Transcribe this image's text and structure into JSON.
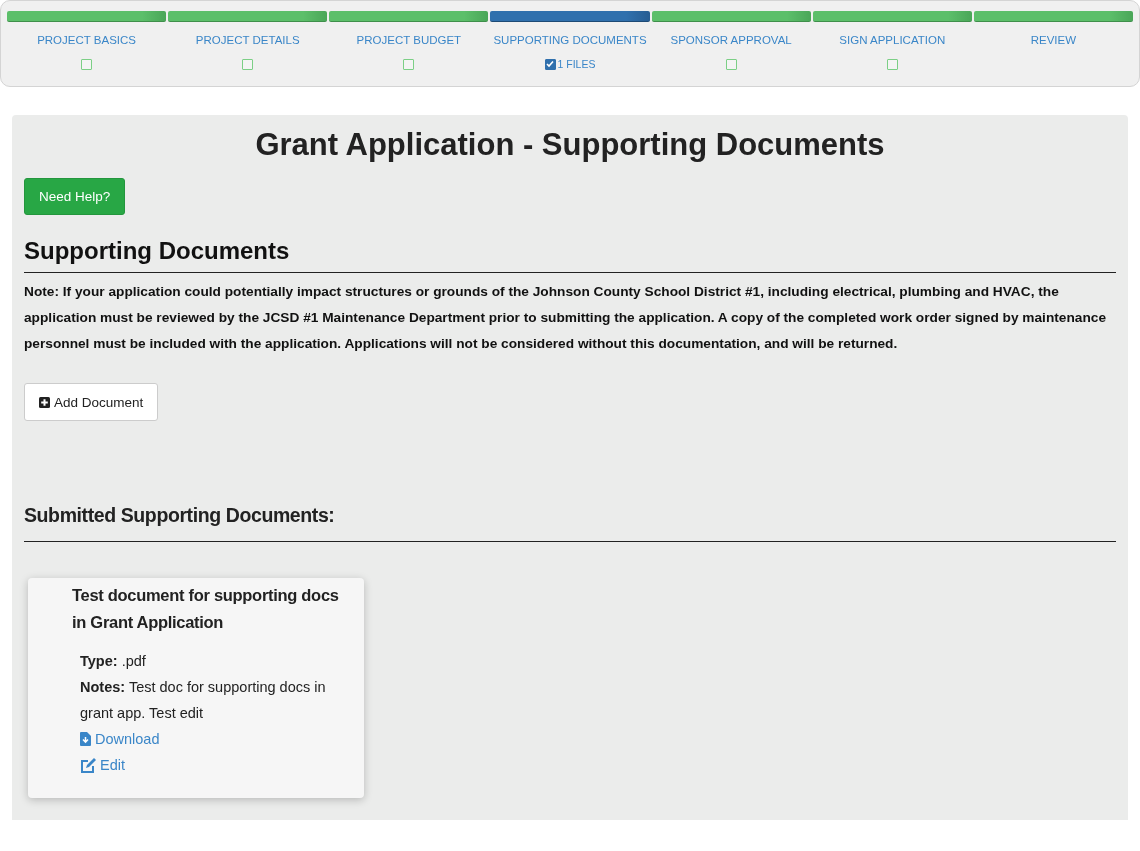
{
  "steps": [
    {
      "label": "PROJECT BASICS",
      "selected": false,
      "checkbox": {
        "checked": false
      }
    },
    {
      "label": "PROJECT DETAILS",
      "selected": false,
      "checkbox": {
        "checked": false
      }
    },
    {
      "label": "PROJECT BUDGET",
      "selected": false,
      "checkbox": {
        "checked": false
      }
    },
    {
      "label": "SUPPORTING DOCUMENTS",
      "selected": true,
      "checkbox": {
        "checked": true
      },
      "files": "1 FILES"
    },
    {
      "label": "SPONSOR APPROVAL",
      "selected": false,
      "checkbox": {
        "checked": false
      }
    },
    {
      "label": "SIGN APPLICATION",
      "selected": false,
      "checkbox": {
        "checked": false
      }
    },
    {
      "label": "REVIEW",
      "selected": false
    }
  ],
  "page_title": "Grant Application - Supporting Documents",
  "help_button": "Need Help?",
  "section_title": "Supporting Documents",
  "note": "Note: If your application could potentially impact structures or grounds of the Johnson County School District #1, including electrical, plumbing and HVAC, the application must be reviewed by the JCSD #1 Maintenance Department prior to submitting the application. A copy of the completed work order signed by maintenance personnel must be included with the application. Applications will not be considered without this documentation, and will be returned.",
  "add_button": "Add Document",
  "submitted_title": "Submitted Supporting Documents:",
  "documents": [
    {
      "title": "Test document for supporting docs in Grant Application",
      "type": "**Type:** .pdf",
      "notes": "**Notes:** Test doc for supporting docs in grant app. Test edit",
      "download": "Download",
      "edit": "Edit"
    }
  ]
}
